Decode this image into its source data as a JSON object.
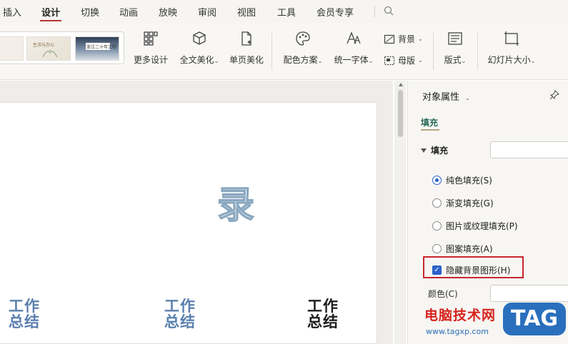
{
  "menu": {
    "items": [
      "插入",
      "设计",
      "切换",
      "动画",
      "放映",
      "审阅",
      "视图",
      "工具",
      "会员专享"
    ],
    "active": "设计"
  },
  "ribbon": {
    "thumb2_text": "生活与办公",
    "thumb3_text": "浙江二十年工程",
    "more_design": "更多设计",
    "full_beautify": "全文美化",
    "page_beautify": "单页美化",
    "color_scheme": "配色方案",
    "unify_font": "统一字体",
    "background": "背景",
    "master": "母版",
    "layout": "版式",
    "slide_size": "幻灯片大小"
  },
  "slide": {
    "glyph": "录",
    "titles": [
      {
        "line1": "工作",
        "line2": "总结",
        "style": "blue"
      },
      {
        "line1": "工作",
        "line2": "总结",
        "style": "blue"
      },
      {
        "line1": "工作",
        "line2": "总结",
        "style": "black"
      }
    ]
  },
  "panel": {
    "title": "对象属性",
    "tab": "填充",
    "section": "填充",
    "options": [
      {
        "label": "纯色填充(S)",
        "selected": true
      },
      {
        "label": "渐变填充(G)",
        "selected": false
      },
      {
        "label": "图片或纹理填充(P)",
        "selected": false
      },
      {
        "label": "图案填充(A)",
        "selected": false
      }
    ],
    "hide_bg_label": "隐藏背景图形(H)",
    "hide_bg_checked": true,
    "color_label": "颜色(C)"
  },
  "watermark": {
    "title": "电脑技术网",
    "url": "www.tagxp.com",
    "tag": "TAG"
  },
  "colors": {
    "accent_red": "#c8262e",
    "checkbox_blue": "#2a62c9",
    "title_blue": "#5a7fae"
  }
}
